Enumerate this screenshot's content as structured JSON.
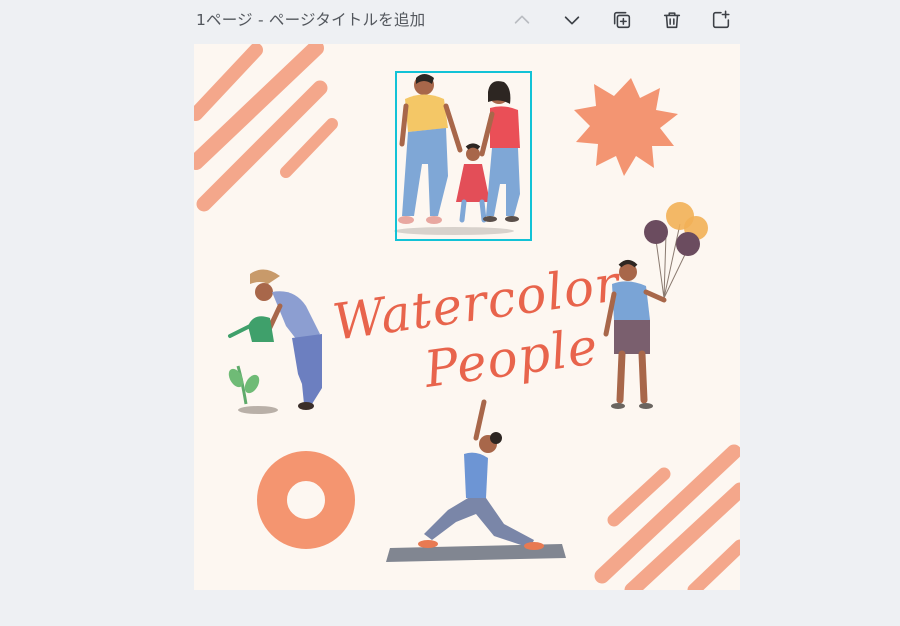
{
  "header": {
    "page_title": "1ページ - ページタイトルを追加"
  },
  "toolbar": {
    "icons": [
      "chevron-up-icon",
      "chevron-down-icon",
      "duplicate-page-icon",
      "trash-icon",
      "add-page-icon"
    ]
  },
  "canvas": {
    "title_line1": "Watercolor",
    "title_line2": "People",
    "colors": {
      "background": "#fdf7f1",
      "accent": "#e8644c",
      "selection": "#12c2d6"
    }
  }
}
